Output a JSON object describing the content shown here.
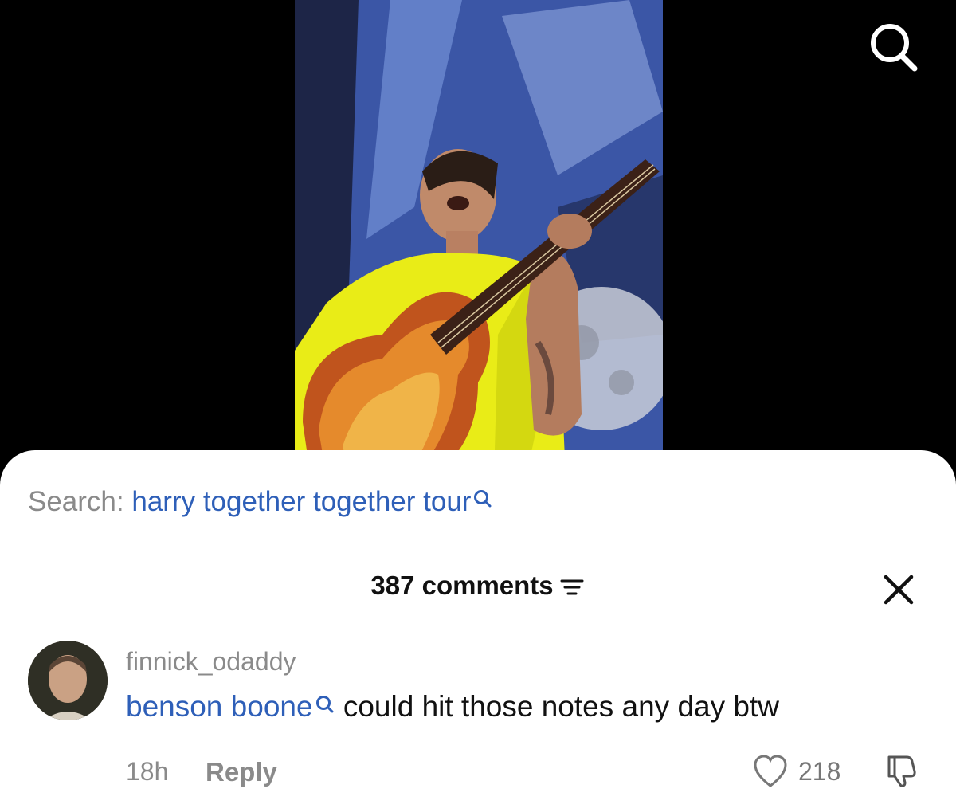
{
  "search": {
    "prefix": "Search: ",
    "query": "harry together together tour",
    "icon": "search-icon"
  },
  "comments": {
    "count_label": "387 comments",
    "filter_icon": "filter-icon",
    "close_icon": "close-icon"
  },
  "comment": {
    "username": "finnick_odaddy",
    "link_text": "benson boone",
    "text": " could hit those notes any day btw",
    "time": "18h",
    "reply_label": "Reply",
    "likes": "218"
  },
  "colors": {
    "link": "#2e5fb8",
    "muted": "#8a8a8a",
    "sheet": "#ffffff",
    "background": "#000000"
  }
}
